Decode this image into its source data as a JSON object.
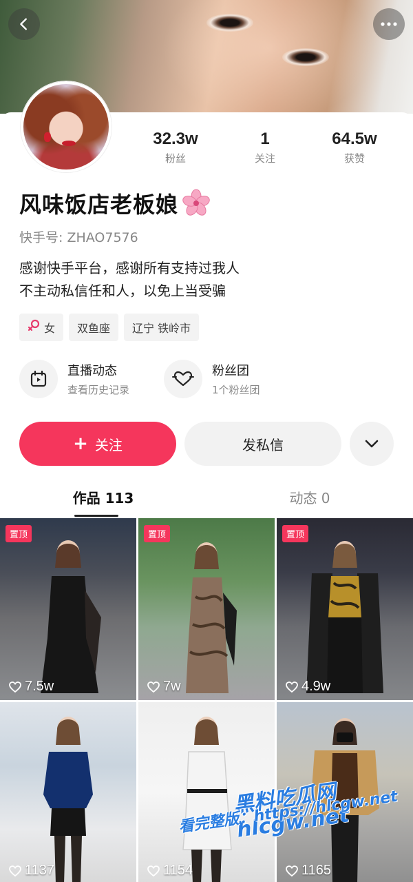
{
  "header": {
    "back_icon": "chevron-left-icon",
    "more_icon": "more-horizontal-icon"
  },
  "profile": {
    "name": "风味饭店老板娘",
    "name_emoji": "cherry-blossom-icon",
    "uid": "快手号: ZHAO7576",
    "bio_line1": "感谢快手平台，感谢所有支持过我人",
    "bio_line2": "不主动私信任和人，以免上当受骗"
  },
  "stats": [
    {
      "value": "32.3w",
      "label": "粉丝"
    },
    {
      "value": "1",
      "label": "关注"
    },
    {
      "value": "64.5w",
      "label": "获赞"
    }
  ],
  "tags": {
    "gender": "女",
    "zodiac": "双鱼座",
    "location": "辽宁 铁岭市"
  },
  "features": {
    "live": {
      "title": "直播动态",
      "sub": "查看历史记录"
    },
    "fans": {
      "title": "粉丝团",
      "sub": "1个粉丝团"
    }
  },
  "actions": {
    "follow": "关注",
    "message": "发私信"
  },
  "tabs": {
    "works": "作品 113",
    "moments": "动态 0"
  },
  "posts": [
    {
      "pinned": "置顶",
      "likes": "7.5w"
    },
    {
      "pinned": "置顶",
      "likes": "7w"
    },
    {
      "pinned": "置顶",
      "likes": "4.9w"
    },
    {
      "likes": "1137"
    },
    {
      "likes": "1154"
    },
    {
      "likes": "1165"
    }
  ],
  "watermark": {
    "line1": "黑料吃瓜网",
    "line1_suffix": "hlcgw.net",
    "line2": "看完整版：https://hlcgw.net"
  },
  "colors": {
    "accent": "#f5365c",
    "muted": "#888888"
  }
}
